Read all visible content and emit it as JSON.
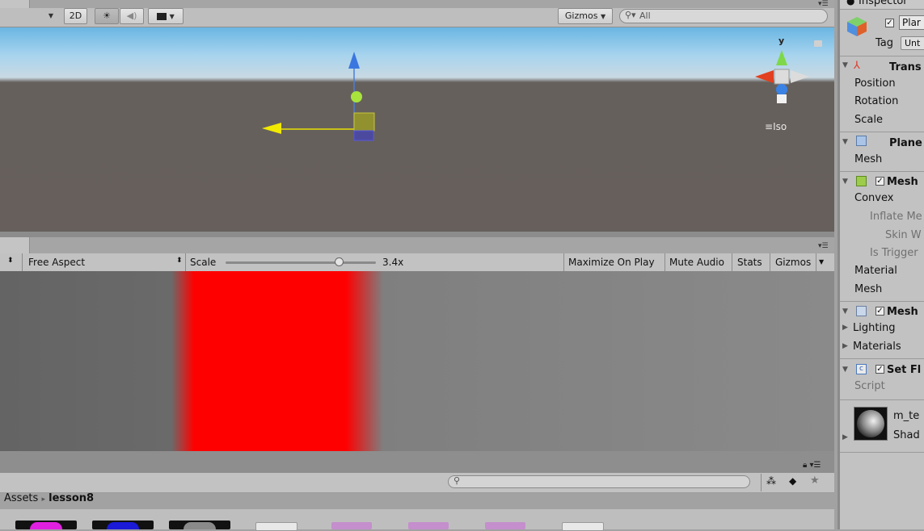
{
  "scene": {
    "toolbar": {
      "mode_2d": "2D",
      "gizmos_label": "Gizmos",
      "search_placeholder": "All"
    },
    "iso_label": "Iso",
    "axis_y_label": "y"
  },
  "game": {
    "aspect_label": "Free Aspect",
    "scale_label": "Scale",
    "scale_value": "3.4x",
    "scale_fraction": 0.75,
    "maximize_label": "Maximize On Play",
    "mute_label": "Mute Audio",
    "stats_label": "Stats",
    "gizmos_label": "Gizmos"
  },
  "project": {
    "breadcrumb_root": "Assets",
    "breadcrumb_current": "lesson8"
  },
  "inspector": {
    "title": "Inspector",
    "object_name": "Plar",
    "tag_label": "Tag",
    "tag_value": "Unt",
    "transform": {
      "header": "Trans",
      "position": "Position",
      "rotation": "Rotation",
      "scale": "Scale"
    },
    "plane": {
      "header": "Plane",
      "mesh": "Mesh"
    },
    "collider": {
      "header": "Mesh",
      "convex": "Convex",
      "inflate": "Inflate Me",
      "skin": "Skin W",
      "trigger": "Is Trigger",
      "material": "Material",
      "mesh": "Mesh"
    },
    "renderer": {
      "header": "Mesh",
      "lighting": "Lighting",
      "materials": "Materials"
    },
    "script": {
      "header": "Set Fl",
      "script_label": "Script"
    },
    "material_asset": {
      "name": "m_te",
      "shader": "Shad"
    }
  },
  "colors": {
    "quad": "#ff0000",
    "sky": "#a8d4ee",
    "ground": "#665f5b"
  }
}
